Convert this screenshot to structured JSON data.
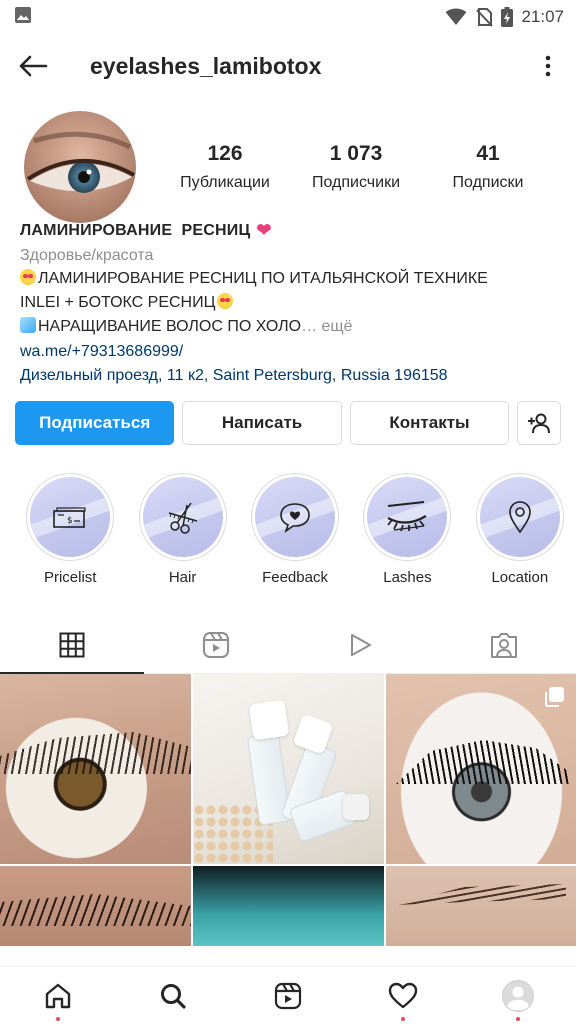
{
  "status_bar": {
    "time": "21:07",
    "icons": [
      "gallery-icon",
      "wifi-icon",
      "no-sim-icon",
      "battery-charging-icon"
    ]
  },
  "header": {
    "username": "eyelashes_lamibotox",
    "back_icon": "arrow-left-icon",
    "more_icon": "vertical-dots-icon"
  },
  "stats": [
    {
      "value": "126",
      "label": "Публикации"
    },
    {
      "value": "1 073",
      "label": "Подписчики"
    },
    {
      "value": "41",
      "label": "Подписки"
    }
  ],
  "bio": {
    "name": "ЛАМИНИРОВАНИЕ  РЕСНИЦ",
    "name_emoji": "❤",
    "category": "Здоровье/красота",
    "line1": "ЛАМИНИРОВАНИЕ РЕСНИЦ ПО ИТАЛЬЯНСКОЙ ТЕХНИКЕ",
    "line2": "INLEI + БОТОКС РЕСНИЦ",
    "line3": "НАРАЩИВАНИЕ ВОЛОС ПО ХОЛО",
    "more": "… ещё",
    "link": "wa.me/+79313686999/",
    "address": "Дизельный проезд, 11 к2, Saint Petersburg, Russia 196158"
  },
  "buttons": {
    "follow": "Подписаться",
    "message": "Написать",
    "contacts": "Контакты"
  },
  "highlights": [
    {
      "label": "Pricelist",
      "icon": "money-icon"
    },
    {
      "label": "Hair",
      "icon": "scissors-comb-icon"
    },
    {
      "label": "Feedback",
      "icon": "heart-chat-icon"
    },
    {
      "label": "Lashes",
      "icon": "lashes-icon"
    },
    {
      "label": "Location",
      "icon": "location-pin-icon"
    }
  ],
  "tabs": [
    {
      "name": "grid",
      "icon": "grid-icon",
      "active": true
    },
    {
      "name": "reels",
      "icon": "reels-icon",
      "active": false
    },
    {
      "name": "videos",
      "icon": "play-icon",
      "active": false
    },
    {
      "name": "tagged",
      "icon": "tagged-icon",
      "active": false
    }
  ],
  "bottom_nav": [
    {
      "name": "home",
      "icon": "home-icon"
    },
    {
      "name": "search",
      "icon": "search-icon"
    },
    {
      "name": "reels",
      "icon": "reels-icon"
    },
    {
      "name": "activity",
      "icon": "heart-icon"
    },
    {
      "name": "profile",
      "icon": "profile-avatar-icon"
    }
  ],
  "colors": {
    "accent": "#1c98f1",
    "link": "#00376b",
    "muted": "#8e8e8e",
    "notification_dot": "#ed4956",
    "highlight_bg": "#c4c8ee"
  }
}
